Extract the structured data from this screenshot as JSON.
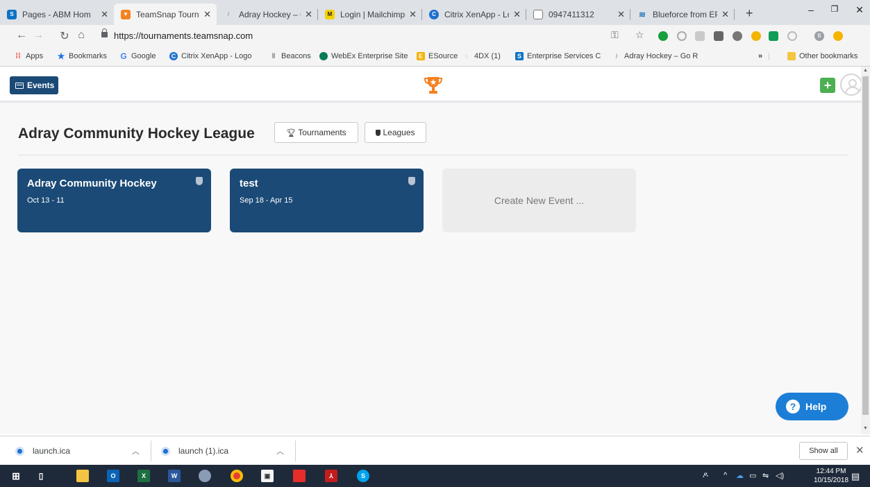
{
  "browser": {
    "tabs": [
      {
        "title": "Pages - ABM Hom",
        "icon": "sharepoint-icon",
        "color": "#0e72c4",
        "glyph": "S"
      },
      {
        "title": "TeamSnap Tourna",
        "icon": "trophy-icon",
        "color": "#f58220",
        "glyph": "T"
      },
      {
        "title": "Adray Hockey – G",
        "icon": "feather-icon",
        "color": "#9aa0a6",
        "glyph": "/"
      },
      {
        "title": "Login | Mailchimp",
        "icon": "mailchimp-icon",
        "color": "#e0b000",
        "glyph": "M"
      },
      {
        "title": "Citrix XenApp - Lo",
        "icon": "citrix-icon",
        "color": "#1e6fd0",
        "glyph": "C"
      },
      {
        "title": "0947411312",
        "icon": "document-icon",
        "color": "#9aa0a6",
        "glyph": ""
      },
      {
        "title": "Blueforce from EP",
        "icon": "blueforce-icon",
        "color": "#2a7ab9",
        "glyph": "B"
      }
    ],
    "url": "https://tournaments.teamsnap.com",
    "bookmarks": [
      {
        "label": "Apps",
        "icon": "apps-grid-icon",
        "color": "#e94235",
        "glyph": "⋮"
      },
      {
        "label": "Bookmarks",
        "icon": "star-icon",
        "color": "#1a73e8",
        "glyph": "★"
      },
      {
        "label": "Google",
        "icon": "google-icon",
        "color": "#4285f4",
        "glyph": "G"
      },
      {
        "label": "Citrix XenApp - Logo",
        "icon": "citrix-icon",
        "color": "#1e6fd0",
        "glyph": "C"
      },
      {
        "label": "Beacons",
        "icon": "antenna-icon",
        "color": "#777777",
        "glyph": "‖"
      },
      {
        "label": "WebEx Enterprise Site",
        "icon": "webex-icon",
        "color": "#0a7b58",
        "glyph": "W"
      },
      {
        "label": "ESource",
        "icon": "esource-icon",
        "color": "#f4b400",
        "glyph": "E"
      },
      {
        "label": "4DX (1)",
        "icon": "loading-icon",
        "color": "#bbbbbb",
        "glyph": "○"
      },
      {
        "label": "Enterprise Services C",
        "icon": "sharepoint-icon",
        "color": "#0e72c4",
        "glyph": "S"
      },
      {
        "label": "Adray Hockey – Go R",
        "icon": "feather-icon",
        "color": "#9aa0a6",
        "glyph": "/"
      }
    ],
    "overflow": "»",
    "other_bookmarks": "Other bookmarks",
    "profile_initial": "B"
  },
  "app": {
    "events_label": "Events",
    "league_title": "Adray Community Hockey League",
    "tournaments_label": "Tournaments",
    "leagues_label": "Leagues",
    "events": [
      {
        "name": "Adray Community Hockey",
        "dates": "Oct 13 - 11"
      },
      {
        "name": "test",
        "dates": "Sep 18 - Apr 15"
      }
    ],
    "create_label": "Create New Event ...",
    "help_label": "Help",
    "brand_color": "#1b4a76",
    "accent_color": "#f58220"
  },
  "downloads": {
    "items": [
      "launch.ica",
      "launch (1).ica"
    ],
    "show_all": "Show all"
  },
  "taskbar": {
    "time": "12:44 PM",
    "date": "10/15/2018"
  }
}
